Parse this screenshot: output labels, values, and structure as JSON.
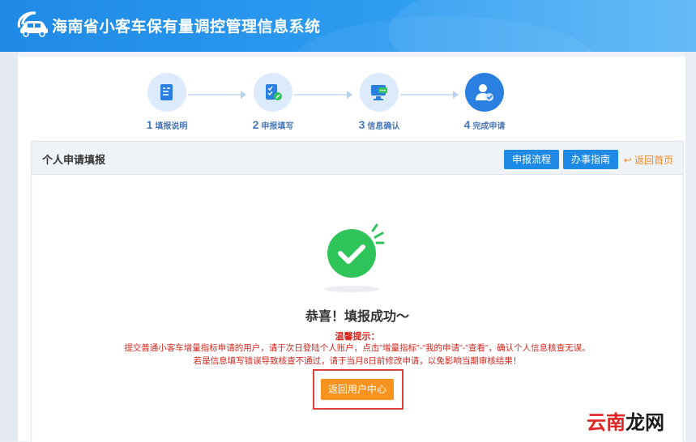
{
  "header": {
    "title": "海南省小客车保有量调控管理信息系统"
  },
  "steps": [
    {
      "num": "1",
      "label": "填报说明"
    },
    {
      "num": "2",
      "label": "申报填写"
    },
    {
      "num": "3",
      "label": "信息确认"
    },
    {
      "num": "4",
      "label": "完成申请"
    }
  ],
  "card": {
    "title": "个人申请填报",
    "btn_process": "申报流程",
    "btn_guide": "办事指南",
    "back_home": "返回首页"
  },
  "result": {
    "congrats": "恭喜！填报成功～",
    "tip_title": "温馨提示：",
    "tip_line1": "提交普通小客车增量指标申请的用户，请于次日登陆个人账户，点击\"增量指标\"-\"我的申请\"-\"查看\"，确认个人信息核查无误。",
    "tip_line2": "若是信息填写错误导致核查不通过，请于当月8日前修改申请，以免影响当期审核结果！",
    "cta": "返回用户中心"
  },
  "watermark": {
    "part1": "云南",
    "part2": "龙网"
  },
  "colors": {
    "header": "#1f8ae6",
    "accent": "#f7931e",
    "warning": "#d8261d",
    "success": "#2fc45a"
  }
}
